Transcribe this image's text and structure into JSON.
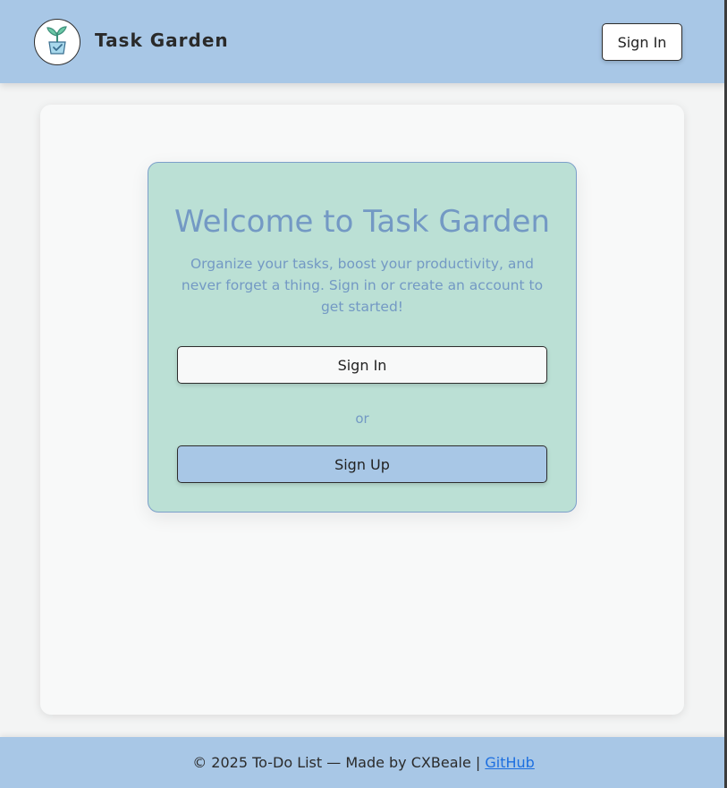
{
  "header": {
    "brand": "Task Garden",
    "logo_icon": "potted-plant-icon",
    "signin_label": "Sign In",
    "background_color": "#a8c7e6"
  },
  "welcome": {
    "title": "Welcome to Task Garden",
    "subtitle": "Organize your tasks, boost your productivity, and never forget a thing. Sign in or create an account to get started!",
    "signin_label": "Sign In",
    "or_text": "or",
    "signup_label": "Sign Up",
    "card_color": "#bbe0d5",
    "accent_text_color": "#7399c4"
  },
  "footer": {
    "text": "© 2025 To-Do List — Made by CXBeale |",
    "link_label": "GitHub",
    "link_color": "#1d6fe0"
  }
}
